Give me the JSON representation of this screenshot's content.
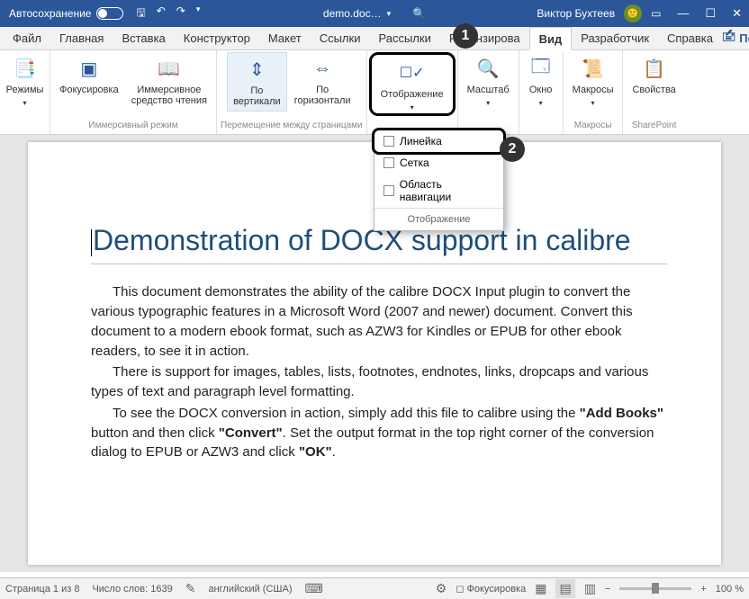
{
  "titlebar": {
    "autosave": "Автосохранение",
    "docname": "demo.doc…",
    "username": "Виктор Бухтеев"
  },
  "tabs": {
    "file": "Файл",
    "home": "Главная",
    "insert": "Вставка",
    "design": "Конструктор",
    "layout": "Макет",
    "refs": "Ссылки",
    "mailings": "Рассылки",
    "review": "Рецензирова",
    "view": "Вид",
    "developer": "Разработчик",
    "help": "Справка",
    "share": "Поделиться"
  },
  "ribbon": {
    "modes": "Режимы",
    "focus": "Фокусировка",
    "immersive": "Иммерсивное\nсредство чтения",
    "immersive_group": "Иммерсивный режим",
    "vertical": "По\nвертикали",
    "horizontal": "По\nгоризонтали",
    "pagemove_group": "Перемещение между страницами",
    "display": "Отображение",
    "zoom": "Масштаб",
    "window": "Окно",
    "macros": "Макросы",
    "macros_group": "Макросы",
    "properties": "Свойства",
    "sharepoint_group": "SharePoint"
  },
  "dropdown": {
    "ruler": "Линейка",
    "grid": "Сетка",
    "navpane": "Область навигации",
    "footer": "Отображение"
  },
  "document": {
    "heading": "Demonstration of DOCX support in calibre",
    "p1": "This document demonstrates the ability of the calibre DOCX Input plugin to convert the various typographic features in a Microsoft Word (2007 and newer) document. Convert this document to a modern ebook format, such as AZW3 for Kindles or EPUB for other ebook readers, to see it in action.",
    "p2": "There is support for images, tables, lists, footnotes, endnotes, links, dropcaps and various types of text and paragraph level formatting.",
    "p3a": "To see the DOCX conversion in action, simply add this file to calibre using the ",
    "p3_bold1": "\"Add Books\"",
    "p3b": " button and then click ",
    "p3_bold2": "\"Convert\"",
    "p3c": ".  Set the output format in the top right corner of the conversion dialog to EPUB or AZW3 and click ",
    "p3_bold3": "\"OK\"",
    "p3d": "."
  },
  "status": {
    "page": "Страница 1 из 8",
    "words": "Число слов: 1639",
    "lang": "английский (США)",
    "focus": "Фокусировка",
    "zoom": "100 %"
  },
  "callouts": {
    "one": "1",
    "two": "2"
  }
}
